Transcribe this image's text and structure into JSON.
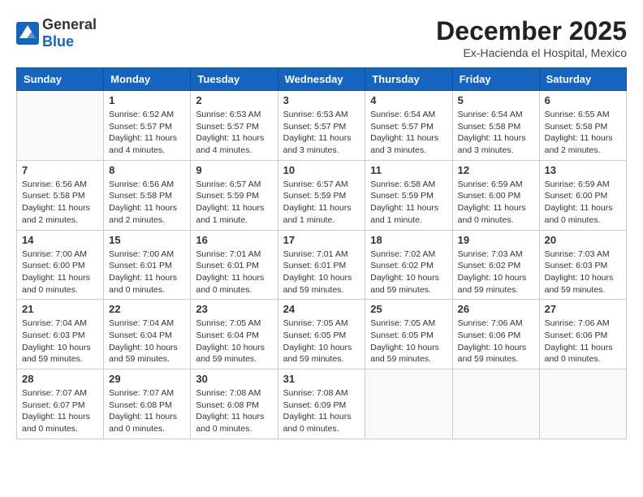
{
  "header": {
    "logo_general": "General",
    "logo_blue": "Blue",
    "title": "December 2025",
    "subtitle": "Ex-Hacienda el Hospital, Mexico"
  },
  "weekdays": [
    "Sunday",
    "Monday",
    "Tuesday",
    "Wednesday",
    "Thursday",
    "Friday",
    "Saturday"
  ],
  "weeks": [
    [
      {
        "day": "",
        "info": ""
      },
      {
        "day": "1",
        "info": "Sunrise: 6:52 AM\nSunset: 5:57 PM\nDaylight: 11 hours\nand 4 minutes."
      },
      {
        "day": "2",
        "info": "Sunrise: 6:53 AM\nSunset: 5:57 PM\nDaylight: 11 hours\nand 4 minutes."
      },
      {
        "day": "3",
        "info": "Sunrise: 6:53 AM\nSunset: 5:57 PM\nDaylight: 11 hours\nand 3 minutes."
      },
      {
        "day": "4",
        "info": "Sunrise: 6:54 AM\nSunset: 5:57 PM\nDaylight: 11 hours\nand 3 minutes."
      },
      {
        "day": "5",
        "info": "Sunrise: 6:54 AM\nSunset: 5:58 PM\nDaylight: 11 hours\nand 3 minutes."
      },
      {
        "day": "6",
        "info": "Sunrise: 6:55 AM\nSunset: 5:58 PM\nDaylight: 11 hours\nand 2 minutes."
      }
    ],
    [
      {
        "day": "7",
        "info": "Sunrise: 6:56 AM\nSunset: 5:58 PM\nDaylight: 11 hours\nand 2 minutes."
      },
      {
        "day": "8",
        "info": "Sunrise: 6:56 AM\nSunset: 5:58 PM\nDaylight: 11 hours\nand 2 minutes."
      },
      {
        "day": "9",
        "info": "Sunrise: 6:57 AM\nSunset: 5:59 PM\nDaylight: 11 hours\nand 1 minute."
      },
      {
        "day": "10",
        "info": "Sunrise: 6:57 AM\nSunset: 5:59 PM\nDaylight: 11 hours\nand 1 minute."
      },
      {
        "day": "11",
        "info": "Sunrise: 6:58 AM\nSunset: 5:59 PM\nDaylight: 11 hours\nand 1 minute."
      },
      {
        "day": "12",
        "info": "Sunrise: 6:59 AM\nSunset: 6:00 PM\nDaylight: 11 hours\nand 0 minutes."
      },
      {
        "day": "13",
        "info": "Sunrise: 6:59 AM\nSunset: 6:00 PM\nDaylight: 11 hours\nand 0 minutes."
      }
    ],
    [
      {
        "day": "14",
        "info": "Sunrise: 7:00 AM\nSunset: 6:00 PM\nDaylight: 11 hours\nand 0 minutes."
      },
      {
        "day": "15",
        "info": "Sunrise: 7:00 AM\nSunset: 6:01 PM\nDaylight: 11 hours\nand 0 minutes."
      },
      {
        "day": "16",
        "info": "Sunrise: 7:01 AM\nSunset: 6:01 PM\nDaylight: 11 hours\nand 0 minutes."
      },
      {
        "day": "17",
        "info": "Sunrise: 7:01 AM\nSunset: 6:01 PM\nDaylight: 10 hours\nand 59 minutes."
      },
      {
        "day": "18",
        "info": "Sunrise: 7:02 AM\nSunset: 6:02 PM\nDaylight: 10 hours\nand 59 minutes."
      },
      {
        "day": "19",
        "info": "Sunrise: 7:03 AM\nSunset: 6:02 PM\nDaylight: 10 hours\nand 59 minutes."
      },
      {
        "day": "20",
        "info": "Sunrise: 7:03 AM\nSunset: 6:03 PM\nDaylight: 10 hours\nand 59 minutes."
      }
    ],
    [
      {
        "day": "21",
        "info": "Sunrise: 7:04 AM\nSunset: 6:03 PM\nDaylight: 10 hours\nand 59 minutes."
      },
      {
        "day": "22",
        "info": "Sunrise: 7:04 AM\nSunset: 6:04 PM\nDaylight: 10 hours\nand 59 minutes."
      },
      {
        "day": "23",
        "info": "Sunrise: 7:05 AM\nSunset: 6:04 PM\nDaylight: 10 hours\nand 59 minutes."
      },
      {
        "day": "24",
        "info": "Sunrise: 7:05 AM\nSunset: 6:05 PM\nDaylight: 10 hours\nand 59 minutes."
      },
      {
        "day": "25",
        "info": "Sunrise: 7:05 AM\nSunset: 6:05 PM\nDaylight: 10 hours\nand 59 minutes."
      },
      {
        "day": "26",
        "info": "Sunrise: 7:06 AM\nSunset: 6:06 PM\nDaylight: 10 hours\nand 59 minutes."
      },
      {
        "day": "27",
        "info": "Sunrise: 7:06 AM\nSunset: 6:06 PM\nDaylight: 11 hours\nand 0 minutes."
      }
    ],
    [
      {
        "day": "28",
        "info": "Sunrise: 7:07 AM\nSunset: 6:07 PM\nDaylight: 11 hours\nand 0 minutes."
      },
      {
        "day": "29",
        "info": "Sunrise: 7:07 AM\nSunset: 6:08 PM\nDaylight: 11 hours\nand 0 minutes."
      },
      {
        "day": "30",
        "info": "Sunrise: 7:08 AM\nSunset: 6:08 PM\nDaylight: 11 hours\nand 0 minutes."
      },
      {
        "day": "31",
        "info": "Sunrise: 7:08 AM\nSunset: 6:09 PM\nDaylight: 11 hours\nand 0 minutes."
      },
      {
        "day": "",
        "info": ""
      },
      {
        "day": "",
        "info": ""
      },
      {
        "day": "",
        "info": ""
      }
    ]
  ]
}
